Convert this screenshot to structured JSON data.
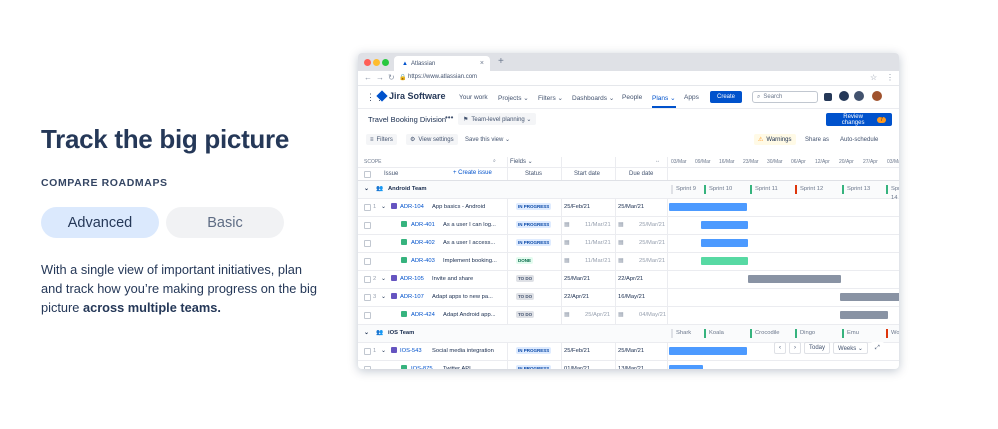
{
  "hero": {
    "title": "Track the big picture",
    "eyebrow": "COMPARE ROADMAPS",
    "tabs": [
      {
        "label": "Advanced",
        "active": true
      },
      {
        "label": "Basic",
        "active": false
      }
    ],
    "description_prefix": "With a single view of important initiatives, plan and track how you’re making progress on the big picture ",
    "description_bold": "across multiple teams."
  },
  "browser": {
    "tab_title": "Atlassian",
    "url": "https://www.atlassian.com",
    "traffic_colors": [
      "#ff5f57",
      "#febc2e",
      "#28c840"
    ]
  },
  "jira_nav": {
    "product": "Jira Software",
    "items": [
      "Your work",
      "Projects ⌄",
      "Filters ⌄",
      "Dashboards ⌄",
      "People",
      "Plans ⌄",
      "Apps"
    ],
    "active_item": "Plans ⌄",
    "create_label": "Create",
    "search_placeholder": "Search"
  },
  "plan": {
    "title": "Travel Booking Division",
    "more": "•••",
    "scenario": "Team-level planning ⌄",
    "review_label": "Review changes",
    "review_count": "7"
  },
  "toolbar": {
    "filters": "Filters",
    "view_settings": "View settings",
    "save_as": "Save this view ⌄",
    "warnings": "Warnings",
    "share": "Share as",
    "auto": "Auto-schedule"
  },
  "table": {
    "scope_label": "SCOPE",
    "fields_label": "Fields ⌄",
    "col_issue": "Issue",
    "create_issue": "+ Create issue",
    "col_status": "Status",
    "col_start": "Start date",
    "col_due": "Due date",
    "timeline_dates": [
      "03/Mar",
      "09/Mar",
      "16/Mar",
      "23/Mar",
      "30/Mar",
      "06/Apr",
      "12/Apr",
      "20/Apr",
      "27/Apr",
      "03/May"
    ],
    "teams": [
      {
        "name": "Android Team",
        "sprints": [
          "Sprint 9",
          "Sprint 10",
          "Sprint 11",
          "Sprint 12",
          "Sprint 13",
          "Sprint 14"
        ]
      },
      {
        "name": "iOS Team",
        "sprints": [
          "Shark",
          "Koala",
          "Crocodile",
          "Dingo",
          "Emu",
          "Wo"
        ]
      }
    ],
    "rows": [
      {
        "num": "1",
        "key": "ADR-104",
        "summary": "App basics - Android",
        "status": "IN PROGRESS",
        "start": "25/Feb/21",
        "due": "25/Mar/21",
        "start_muted": false
      },
      {
        "num": "",
        "key": "ADR-401",
        "summary": "As a user I can log...",
        "status": "IN PROGRESS",
        "start": "11/Mar/21",
        "due": "25/Mar/21",
        "start_muted": true
      },
      {
        "num": "",
        "key": "ADR-402",
        "summary": "As a user I access...",
        "status": "IN PROGRESS",
        "start": "11/Mar/21",
        "due": "25/Mar/21",
        "start_muted": true
      },
      {
        "num": "",
        "key": "ADR-403",
        "summary": "Implement booking...",
        "status": "DONE",
        "start": "11/Mar/21",
        "due": "25/Mar/21",
        "start_muted": true
      },
      {
        "num": "2",
        "key": "ADR-105",
        "summary": "Invite and share",
        "status": "TO DO",
        "start": "25/Mar/21",
        "due": "22/Apr/21",
        "start_muted": false
      },
      {
        "num": "3",
        "key": "ADR-107",
        "summary": "Adapt apps to new pa...",
        "status": "TO DO",
        "start": "22/Apr/21",
        "due": "16/May/21",
        "start_muted": false
      },
      {
        "num": "",
        "key": "ADR-424",
        "summary": "Adapt Android app...",
        "status": "TO DO",
        "start": "25/Apr/21",
        "due": "04/May/21",
        "start_muted": true
      },
      {
        "num": "1",
        "key": "IOS-543",
        "summary": "Social media integration",
        "status": "IN PROGRESS",
        "start": "25/Feb/21",
        "due": "25/Mar/21",
        "start_muted": false
      },
      {
        "num": "",
        "key": "IOS-875",
        "summary": "Twitter API",
        "status": "IN PROGRESS",
        "start": "01/Mar/21",
        "due": "13/Mar/21",
        "start_muted": false
      }
    ]
  },
  "timeline_controls": {
    "prev": "‹",
    "next": "›",
    "today": "Today",
    "scale": "Weeks ⌄",
    "expand": "⤢"
  }
}
